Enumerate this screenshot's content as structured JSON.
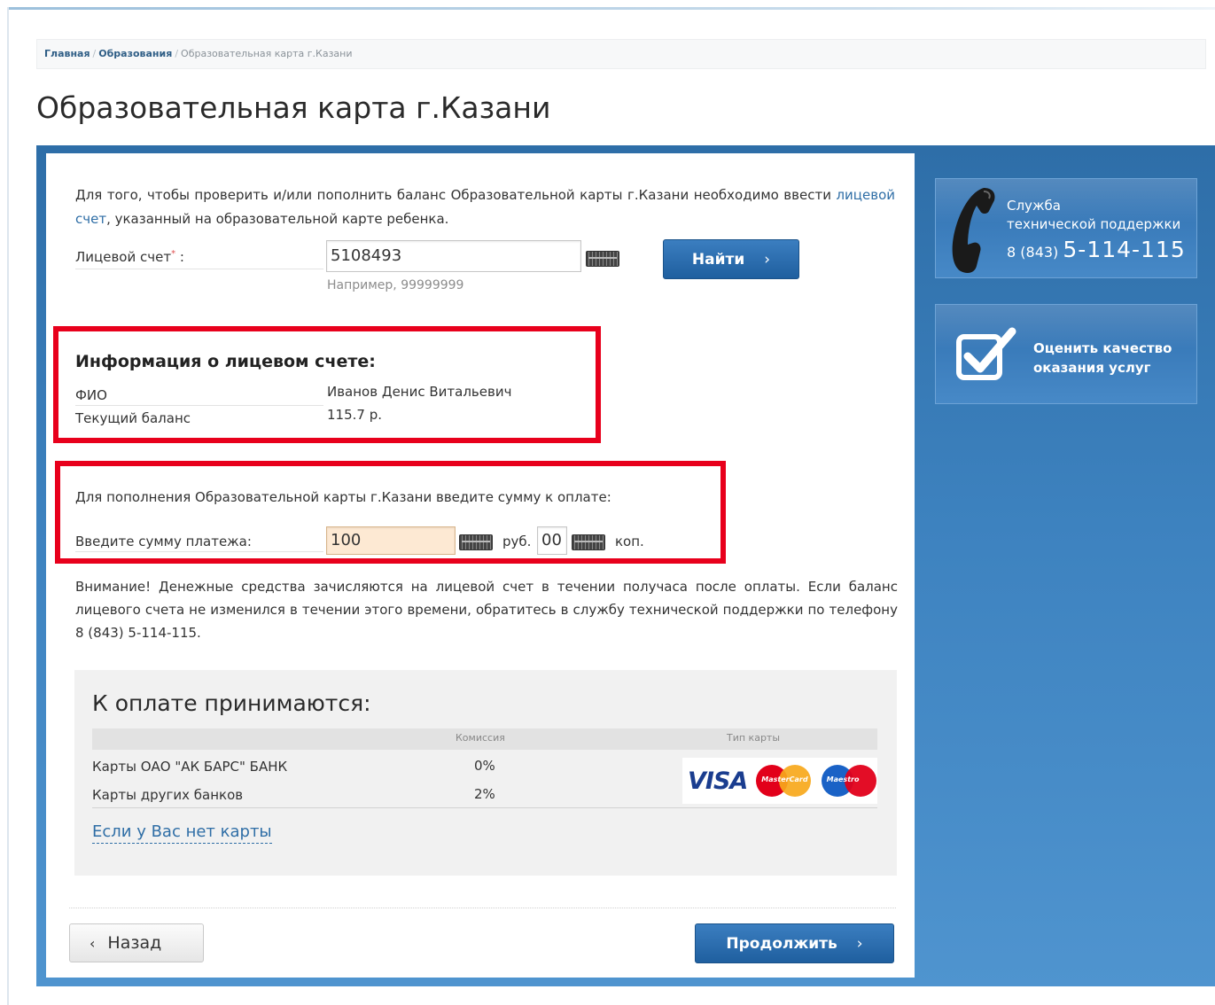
{
  "breadcrumb": {
    "home": "Главная",
    "section": "Образования",
    "current": "Образовательная карта г.Казани",
    "separator": "/"
  },
  "page_title": "Образовательная карта г.Казани",
  "intro": {
    "text_before": "Для того, чтобы проверить и/или пополнить баланс Образовательной карты г.Казани необходимо ввести",
    "link": "лицевой счет",
    "text_after": ", указанный на образовательной карте ребенка."
  },
  "account": {
    "label": "Лицевой счет",
    "required_mark": "*",
    "colon": ":",
    "value": "5108493",
    "hint": "Например, 99999999",
    "find_button": "Найти",
    "arrow": "›"
  },
  "account_info": {
    "title": "Информация о лицевом счете:",
    "fio_label": "ФИО",
    "fio_value": "Иванов Денис Витальевич",
    "balance_label": "Текущий баланс",
    "balance_value": "115.7 р."
  },
  "topup": {
    "instruction": "Для пополнения Образовательной карты г.Казани введите сумму к оплате:",
    "amount_label": "Введите сумму платежа:",
    "rub_value": "100",
    "rub_unit": "руб.",
    "kop_value": "00",
    "kop_unit": "коп."
  },
  "notice": "Внимание! Денежные средства зачисляются на лицевой счет в течении получаса после оплаты. Если баланс лицевого счета не изменился в течении этого времени, обратитесь в службу технической поддержки по телефону 8 (843) 5-114-115.",
  "payment": {
    "title": "К оплате принимаются:",
    "col_commission": "Комиссия",
    "col_card_type": "Тип карты",
    "rows": [
      {
        "name": "Карты ОАО \"АК БАРС\" БАНК",
        "commission": "0%"
      },
      {
        "name": "Карты других банков",
        "commission": "2%"
      }
    ],
    "logos": {
      "visa": "VISA",
      "mastercard": "MasterCard",
      "maestro": "Maestro"
    },
    "no_card_link": "Если у Вас нет карты"
  },
  "nav": {
    "back": "Назад",
    "back_arrow": "‹",
    "continue": "Продолжить",
    "continue_arrow": "›"
  },
  "sidebar": {
    "support_line1": "Служба",
    "support_line2": "технической поддержки",
    "support_prefix": "8 (843)",
    "support_number": "5-114-115",
    "rate_line1": "Оценить качество",
    "rate_line2": "оказания услуг"
  },
  "colors": {
    "accent_blue": "#2f6ea6",
    "highlight_red": "#e8001c",
    "sidebar_blue": "#3d82bf"
  }
}
